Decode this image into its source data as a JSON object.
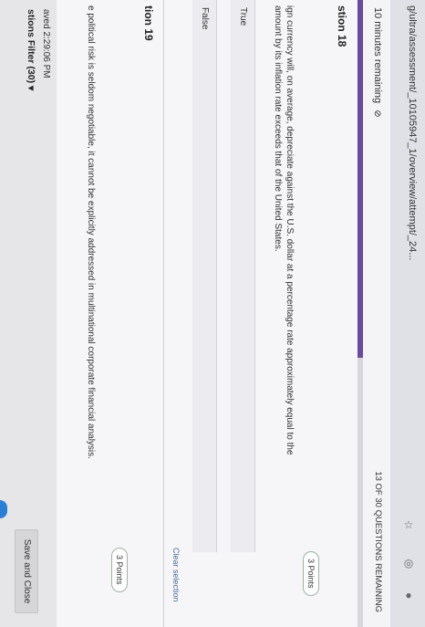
{
  "browser": {
    "url_text": "g/ultra/assessment/_10105947_1/overview/attempt/_24..."
  },
  "header": {
    "timer": "10 minutes remaining",
    "timer_icon": "eye-slash-icon",
    "remaining": "13 OF 30 QUESTIONS REMAINING",
    "progress": 0.57
  },
  "questions": [
    {
      "title": "stion 18",
      "points": "3 Points",
      "text": "ign currency will, on average, depreciate against the U.S. dollar at a percentage rate approximately equal to the amount by its inflation rate exceeds that of the United States.",
      "options": [
        "True",
        "False"
      ],
      "clear": "Clear selection"
    },
    {
      "title": "tion 19",
      "points": "3 Points",
      "text": "e political risk is seldom negotiable, it cannot be explicitly addressed in multinational corporate financial analysis."
    }
  ],
  "footer": {
    "saved": "aved 2:29:06 PM",
    "filter": "stions Filter (30)",
    "filter_arrow": "▾",
    "save_close": "Save and Close"
  }
}
